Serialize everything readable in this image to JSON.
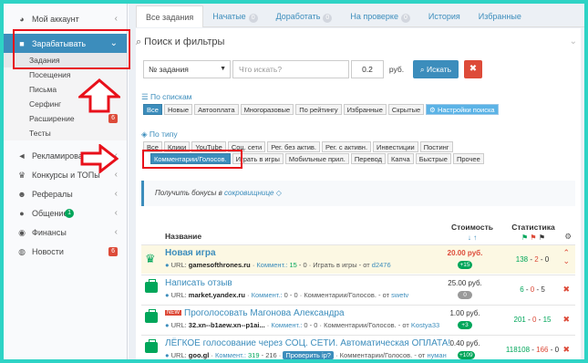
{
  "sidebar": {
    "items": [
      {
        "label": "Мой аккаунт",
        "icon": "dashboard-icon"
      },
      {
        "label": "Зарабатывать",
        "icon": "briefcase-icon"
      },
      {
        "label": "Рекламировать",
        "icon": "megaphone-icon"
      },
      {
        "label": "Конкурсы и ТОПы",
        "icon": "trophy-icon"
      },
      {
        "label": "Рефералы",
        "icon": "users-icon"
      },
      {
        "label": "Общение",
        "icon": "chat-icon",
        "badge": "1"
      },
      {
        "label": "Финансы",
        "icon": "coins-icon"
      },
      {
        "label": "Новости",
        "icon": "globe-icon",
        "badge": "6"
      }
    ],
    "sub": [
      {
        "label": "Задания"
      },
      {
        "label": "Посещения"
      },
      {
        "label": "Письма"
      },
      {
        "label": "Серфинг"
      },
      {
        "label": "Расширение",
        "badge": "6"
      },
      {
        "label": "Тесты"
      }
    ]
  },
  "tabs": [
    {
      "label": "Все задания"
    },
    {
      "label": "Начатые",
      "count": "0"
    },
    {
      "label": "Доработать",
      "count": "0"
    },
    {
      "label": "На проверке",
      "count": "0"
    },
    {
      "label": "История"
    },
    {
      "label": "Избранные"
    }
  ],
  "filters": {
    "title": "Поиск и фильтры",
    "select_value": "№ задания",
    "search_placeholder": "Что искать?",
    "price_value": "0.2",
    "currency": "руб.",
    "find_label": "Искать",
    "lists_label": "По спискам",
    "lists": [
      "Все",
      "Новые",
      "Автооплата",
      "Многоразовые",
      "По рейтингу",
      "Избранные",
      "Скрытые",
      "Настройки поиска"
    ],
    "types_label": "По типу",
    "types_row1": [
      "Все",
      "Клики",
      "YouTube",
      "Соц. сети",
      "Рег. без актив.",
      "Рег. с активн.",
      "Инвестиции",
      "Постинг"
    ],
    "types_row2": [
      "Комментарии/Голосов.",
      "Играть в игры",
      "Мобильные прил.",
      "Перевод",
      "Капча",
      "Быстрые",
      "Прочее"
    ]
  },
  "bonus": {
    "text": "Получить бонусы в",
    "link": "сокровищнице"
  },
  "table": {
    "col_name": "Название",
    "col_cost": "Стоимость",
    "col_stats": "Статистика",
    "rows": [
      {
        "title": "Новая игра",
        "url": "gamesofthrones.ru",
        "comments": "15",
        "comments_b": "0",
        "category": "Играть в игры",
        "author": "d2476",
        "price": "20.00 руб.",
        "pbadge": "+15",
        "stats": [
          "138",
          "2",
          "0"
        ]
      },
      {
        "title": "Написать отзыв",
        "url": "market.yandex.ru",
        "comments": "0",
        "comments_b": "0",
        "category": "Комментарии/Голосов.",
        "author": "swetv",
        "price": "25.00 руб.",
        "pbadge": "0",
        "stats": [
          "6",
          "0",
          "5"
        ]
      },
      {
        "title": "Проголосовать Магонова Александра",
        "url": "32.xn--b1aew.xn--p1ai...",
        "comments": "0",
        "comments_b": "0",
        "category": "Комментарии/Голосов.",
        "author": "Kostya33",
        "price": "1.00 руб.",
        "pbadge": "+3",
        "stats": [
          "201",
          "0",
          "15"
        ],
        "new": "NEW"
      },
      {
        "title": "ЛЁГКОЕ голосование через СОЦ. СЕТИ. Автоматическая ОПЛАТА!",
        "url": "goo.gl",
        "comments": "319",
        "comments_b": "216",
        "category": "Комментарии/Голосов.",
        "author": "нуман",
        "price": "0.40 руб.",
        "pbadge": "+109",
        "stats": [
          "118108",
          "166",
          "0"
        ],
        "verify": "Проверить ip?"
      }
    ]
  }
}
